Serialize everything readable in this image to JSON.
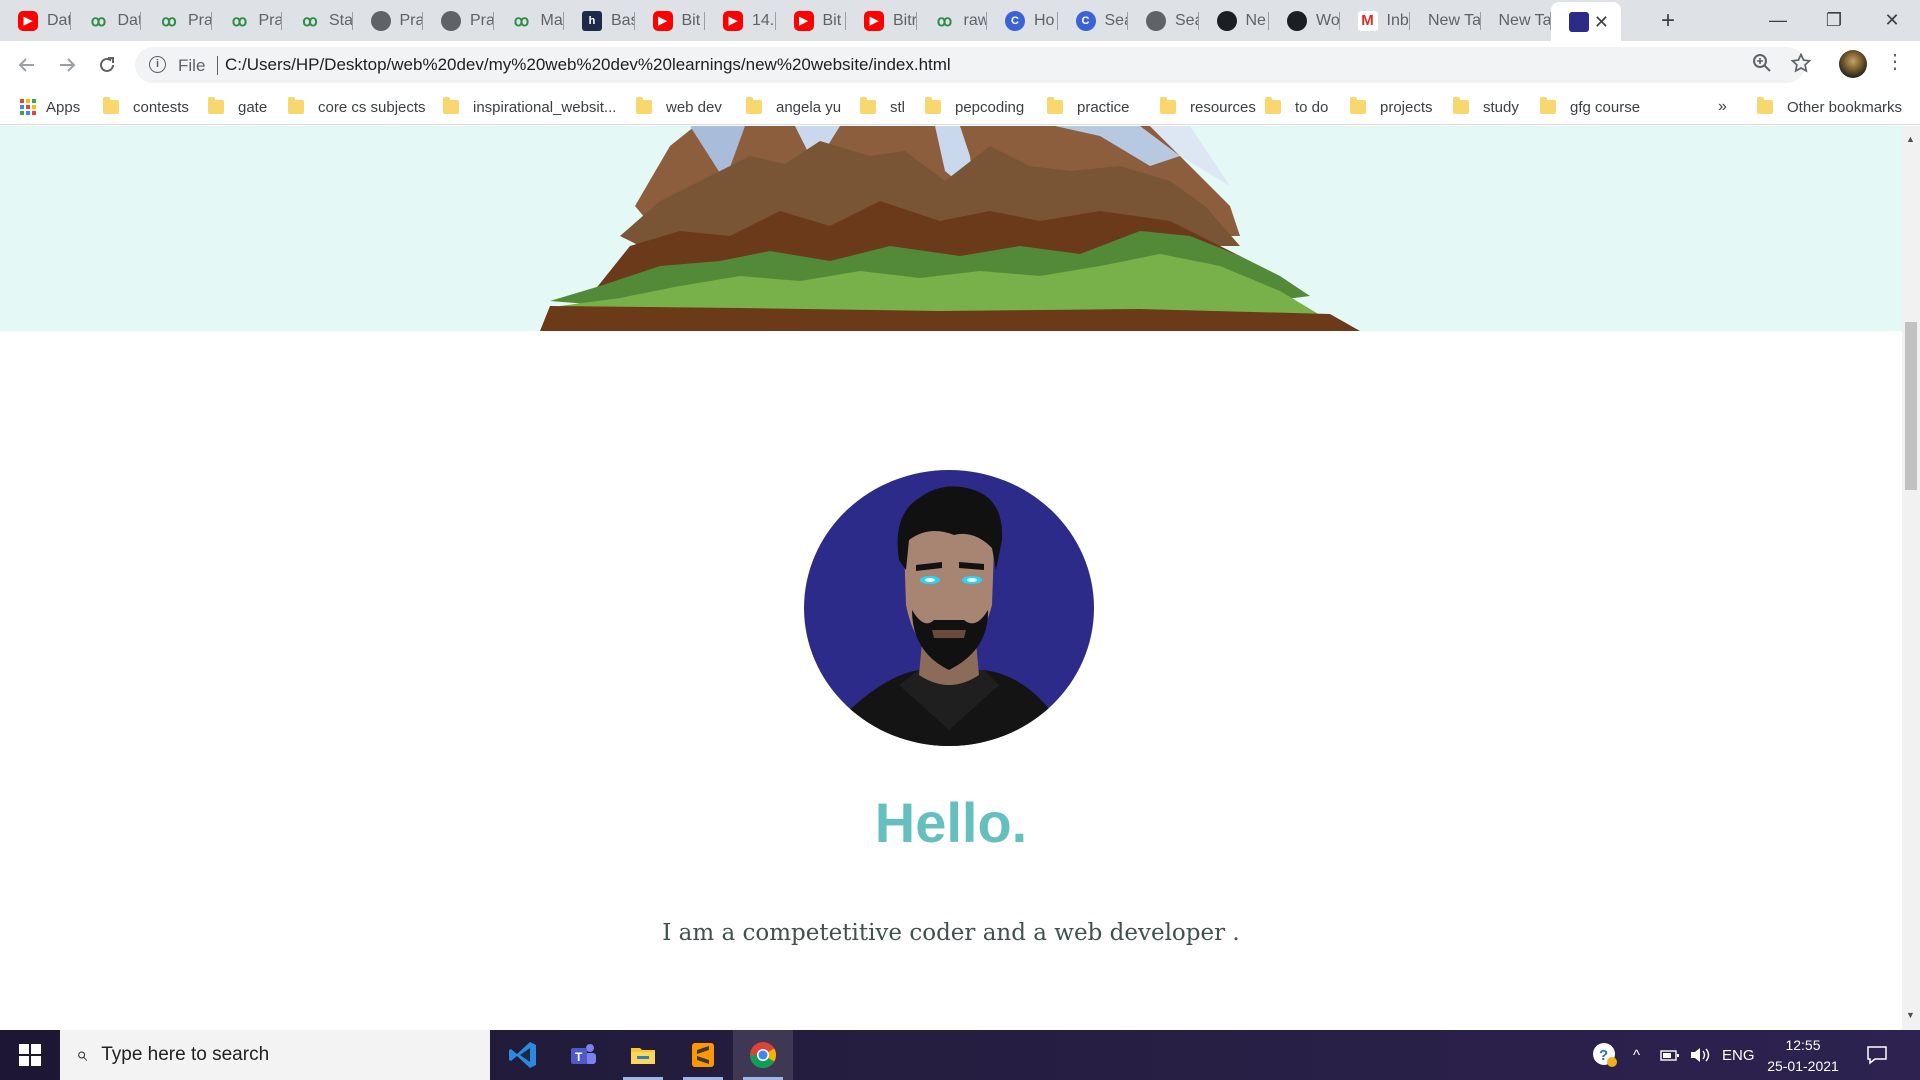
{
  "browser": {
    "tabs": [
      {
        "icon": "youtube-icon",
        "label": "Dat"
      },
      {
        "icon": "gfg-icon",
        "label": "Dat"
      },
      {
        "icon": "gfg-icon",
        "label": "Pra"
      },
      {
        "icon": "gfg-icon",
        "label": "Pra"
      },
      {
        "icon": "gfg-icon",
        "label": "Sta"
      },
      {
        "icon": "globe-icon",
        "label": "Pra"
      },
      {
        "icon": "globe-icon",
        "label": "Pra"
      },
      {
        "icon": "gfg-icon",
        "label": "Ma"
      },
      {
        "icon": "hackerrank-icon",
        "label": "Bas"
      },
      {
        "icon": "youtube-icon",
        "label": "Bit"
      },
      {
        "icon": "youtube-icon",
        "label": "14."
      },
      {
        "icon": "youtube-icon",
        "label": "Bit"
      },
      {
        "icon": "youtube-icon",
        "label": "Bitr"
      },
      {
        "icon": "gfg-icon",
        "label": "raw"
      },
      {
        "icon": "codechef-icon",
        "label": "Ho"
      },
      {
        "icon": "codechef-icon",
        "label": "Sea"
      },
      {
        "icon": "globe-icon",
        "label": "Sea"
      },
      {
        "icon": "github-icon",
        "label": "Ne"
      },
      {
        "icon": "github-icon",
        "label": "Wo"
      },
      {
        "icon": "gmail-icon",
        "label": "Inb"
      },
      {
        "icon": "none",
        "label": "New Ta"
      },
      {
        "icon": "none",
        "label": "New Ta"
      }
    ],
    "active_tab_close": "✕",
    "new_tab": "+",
    "window_controls": {
      "minimize": "—",
      "restore": "❐",
      "close": "✕"
    },
    "address": {
      "scheme_label": "File",
      "url": "C:/Users/HP/Desktop/web%20dev/my%20web%20dev%20learnings/new%20website/index.html"
    },
    "bookmarks": [
      "Apps",
      "contests",
      "gate",
      "core cs subjects",
      "inspirational_websit...",
      "web dev",
      "angela yu",
      "stl",
      "pepcoding",
      "practice",
      "resources",
      "to do",
      "projects",
      "study",
      "gfg course"
    ],
    "bookmarks_overflow": "»",
    "other_bookmarks": "Other bookmarks"
  },
  "page": {
    "greeting": "Hello.",
    "intro": "I am a competetitive coder and a web developer .",
    "colors": {
      "hero_bg": "#e4f9f5",
      "heading": "#66bfbf",
      "body_text": "#40514e",
      "avatar_bg": "#2d2b8a"
    }
  },
  "taskbar": {
    "search_placeholder": "Type here to search",
    "apps": [
      "vscode-icon",
      "teams-icon",
      "file-explorer-icon",
      "sublime-text-icon",
      "chrome-icon"
    ],
    "language": "ENG",
    "time": "12:55",
    "date": "25-01-2021"
  }
}
